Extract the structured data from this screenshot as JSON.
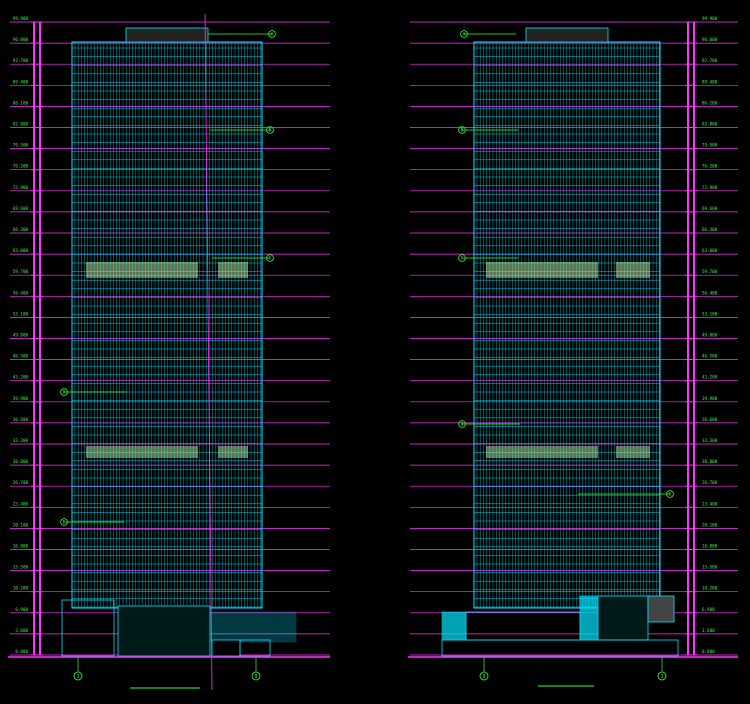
{
  "drawing": {
    "colors": {
      "background": "#000000",
      "facade": "#00e5ff",
      "level": "#ff33ff",
      "annotation": "#33ff33",
      "band": "#ccffaa",
      "text": "#e0e0e0",
      "ground": "#ff33ff"
    },
    "elevation_labels_left": [
      "99.900",
      "96.000",
      "92.700",
      "89.400",
      "86.100",
      "82.800",
      "79.500",
      "76.200",
      "72.900",
      "69.600",
      "66.300",
      "63.000",
      "59.700",
      "56.400",
      "53.100",
      "49.800",
      "46.500",
      "43.200",
      "39.900",
      "36.600",
      "33.300",
      "30.000",
      "26.700",
      "23.400",
      "20.100",
      "16.800",
      "13.500",
      "10.200",
      "6.900",
      "3.600",
      "0.000"
    ],
    "elevation_labels_right": [
      "99.900",
      "96.000",
      "92.700",
      "89.400",
      "86.100",
      "82.800",
      "79.500",
      "76.200",
      "72.900",
      "69.600",
      "66.300",
      "63.000",
      "59.700",
      "56.400",
      "53.100",
      "49.800",
      "46.500",
      "43.200",
      "39.900",
      "36.600",
      "33.300",
      "30.000",
      "26.700",
      "23.400",
      "20.100",
      "16.800",
      "13.500",
      "10.200",
      "6.900",
      "3.600",
      "0.000"
    ],
    "left_tags": [
      "A",
      "B",
      "C",
      "D",
      "E"
    ],
    "right_tags": [
      "A",
      "B",
      "C",
      "D",
      "E"
    ],
    "axis_left": [
      "1",
      "9"
    ],
    "axis_right": [
      "9",
      "1"
    ]
  }
}
